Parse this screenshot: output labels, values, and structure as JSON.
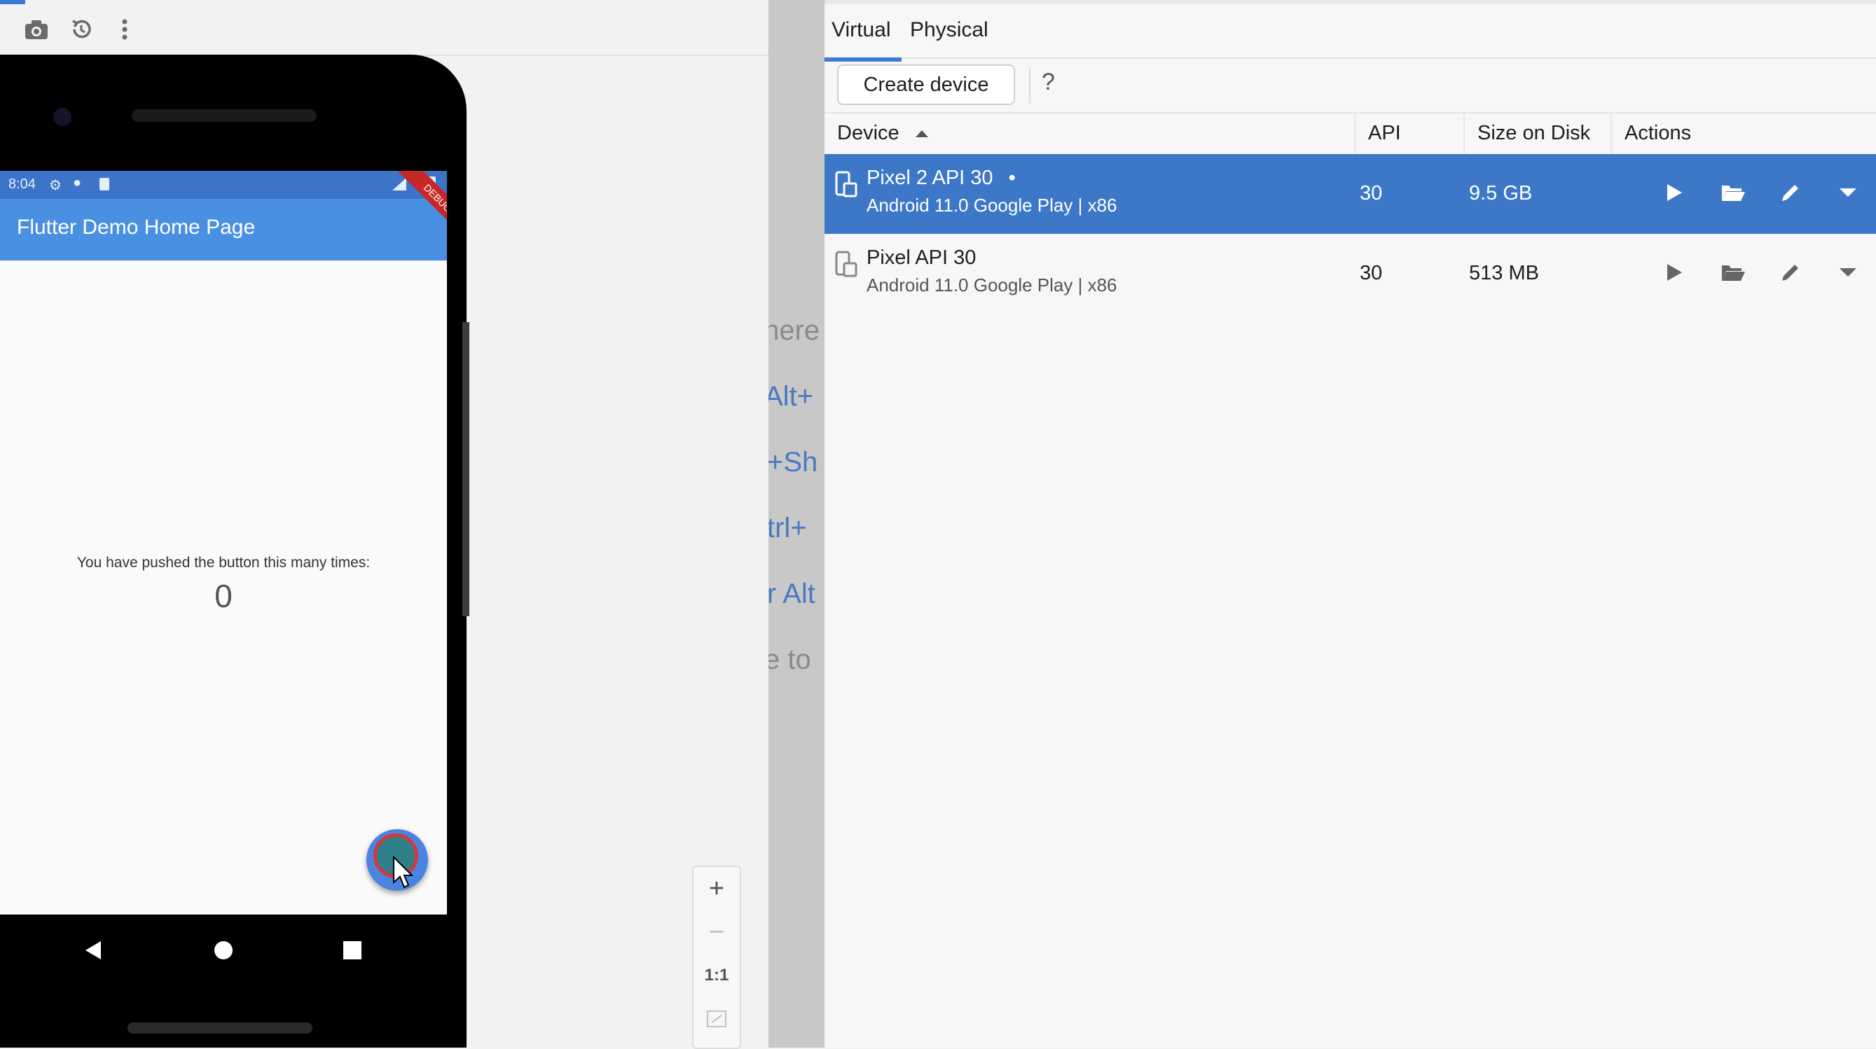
{
  "emulator": {
    "toolbar": {
      "icons": [
        "camera-icon",
        "history-icon",
        "more-vertical-icon"
      ]
    },
    "status_time": "8:04",
    "app_bar_title": "Flutter Demo Home Page",
    "debug_ribbon": "DEBUG",
    "counter_label": "You have pushed the button this many times:",
    "counter_value": "0"
  },
  "zoom": {
    "zoom_in": "+",
    "zoom_out": "−",
    "actual_size": "1:1"
  },
  "editor_hints": [
    "/here",
    "Alt+",
    "+Sh",
    "trl+",
    "r Alt",
    "e to"
  ],
  "device_manager": {
    "tabs": [
      "Virtual",
      "Physical"
    ],
    "active_tab": "Virtual",
    "create_button": "Create device",
    "help": "?",
    "columns": {
      "device": "Device",
      "api": "API",
      "size": "Size on Disk",
      "actions": "Actions"
    },
    "devices": [
      {
        "name": "Pixel 2 API 30",
        "running_indicator": "•",
        "details": "Android 11.0 Google Play | x86",
        "api": "30",
        "size": "9.5 GB",
        "selected": true
      },
      {
        "name": "Pixel API 30",
        "running_indicator": "",
        "details": "Android 11.0 Google Play | x86",
        "api": "30",
        "size": "513 MB",
        "selected": false
      }
    ]
  },
  "colors": {
    "accent": "#3d7bd5",
    "selected_row": "#3d78c8",
    "app_bar": "#4a90e2",
    "status_bar": "#3c74c9",
    "fab": "#4a84e0"
  }
}
